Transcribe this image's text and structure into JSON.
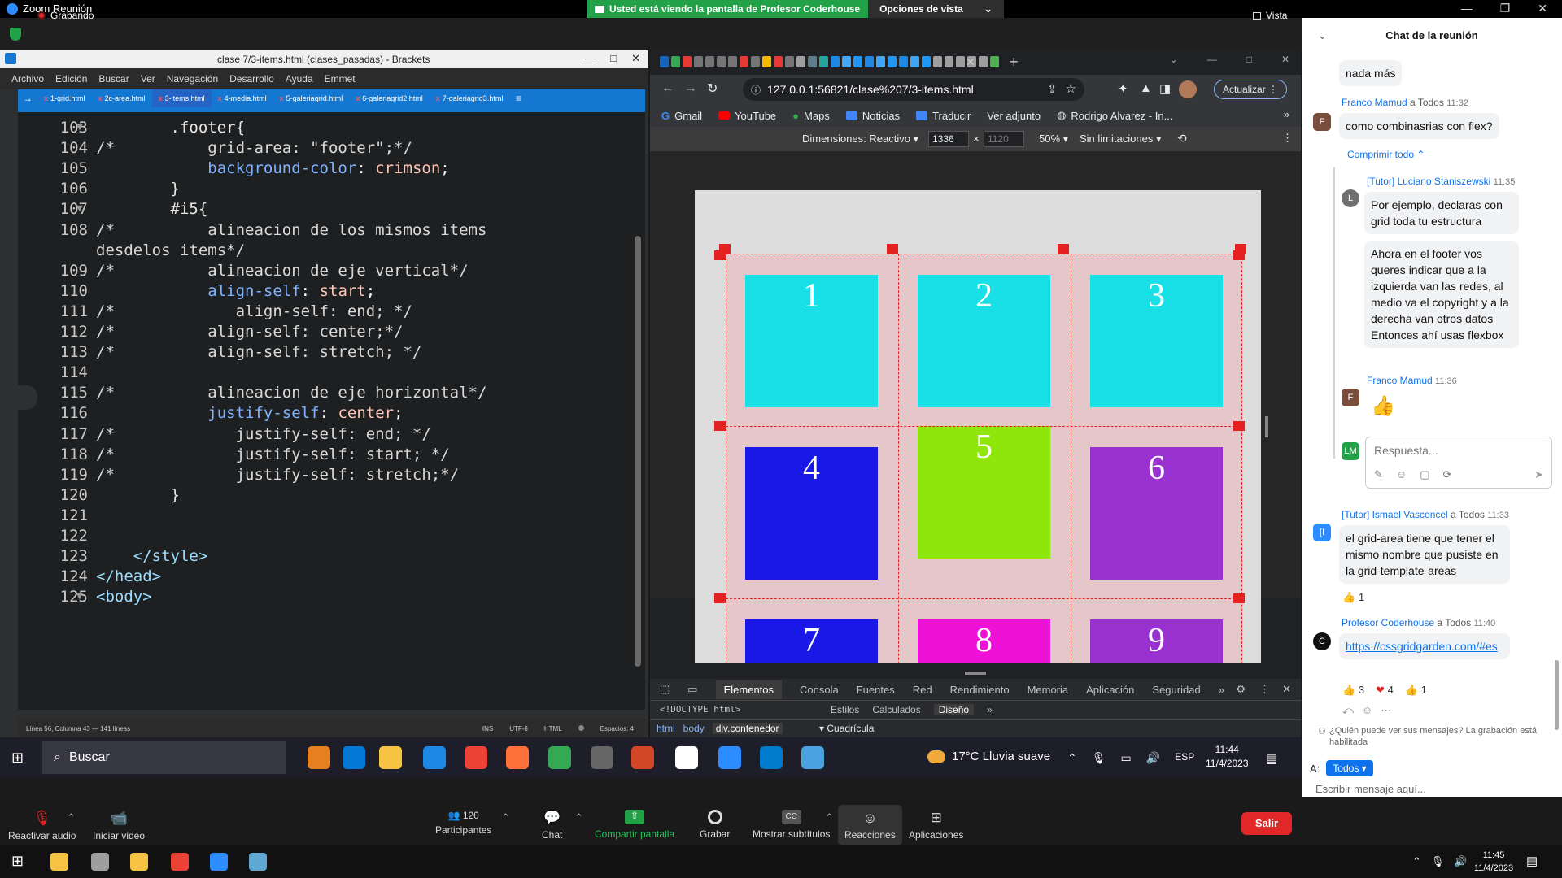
{
  "zoom": {
    "title": "Zoom Reunión",
    "banner_text": "Usted está viendo la pantalla de Profesor Coderhouse",
    "view_options": "Opciones de vista",
    "recording": "Grabando",
    "view": "Vista"
  },
  "brackets": {
    "title": "clase 7/3-items.html (clases_pasadas) - Brackets",
    "menu": [
      "Archivo",
      "Edición",
      "Buscar",
      "Ver",
      "Navegación",
      "Desarrollo",
      "Ayuda",
      "Emmet"
    ],
    "tabs": [
      "1-grid.html",
      "2c-area.html",
      "3-items.html",
      "4-media.html",
      "5-galeriagrid.html",
      "6-galeriagrid2.html",
      "7-galeriagrid3.html"
    ],
    "status_left": "Línea 56, Columna 43 — 141 líneas",
    "status_right": [
      "INS",
      "UTF-8",
      "HTML",
      "Espacios: 4"
    ],
    "lines": [
      {
        "n": "103",
        "fold": true,
        "code": "        .footer{"
      },
      {
        "n": "104",
        "fold": false,
        "code": "/*          grid-area: \"footer\";*/"
      },
      {
        "n": "105",
        "fold": false,
        "code": "            background-color: crimson;"
      },
      {
        "n": "106",
        "fold": false,
        "code": "        }"
      },
      {
        "n": "107",
        "fold": true,
        "code": "        #i5{"
      },
      {
        "n": "108",
        "fold": false,
        "code": "/*          alineacion de los mismos items"
      },
      {
        "n": "",
        "fold": false,
        "code": "desdelos items*/"
      },
      {
        "n": "109",
        "fold": false,
        "code": "/*          alineacion de eje vertical*/"
      },
      {
        "n": "110",
        "fold": false,
        "code": "            align-self: start;"
      },
      {
        "n": "111",
        "fold": false,
        "code": "/*             align-self: end; */"
      },
      {
        "n": "112",
        "fold": false,
        "code": "/*          align-self: center;*/"
      },
      {
        "n": "113",
        "fold": false,
        "code": "/*          align-self: stretch; */"
      },
      {
        "n": "114",
        "fold": false,
        "code": ""
      },
      {
        "n": "115",
        "fold": false,
        "code": "/*          alineacion de eje horizontal*/"
      },
      {
        "n": "116",
        "fold": false,
        "code": "            justify-self: center;"
      },
      {
        "n": "117",
        "fold": false,
        "code": "/*             justify-self: end; */"
      },
      {
        "n": "118",
        "fold": false,
        "code": "/*             justify-self: start; */"
      },
      {
        "n": "119",
        "fold": false,
        "code": "/*             justify-self: stretch;*/"
      },
      {
        "n": "120",
        "fold": false,
        "code": "        }"
      },
      {
        "n": "121",
        "fold": false,
        "code": ""
      },
      {
        "n": "122",
        "fold": false,
        "code": ""
      },
      {
        "n": "123",
        "fold": false,
        "code": "    </style>"
      },
      {
        "n": "124",
        "fold": false,
        "code": "</head>"
      },
      {
        "n": "125",
        "fold": true,
        "code": "<body>"
      }
    ]
  },
  "chrome": {
    "url": "127.0.0.1:56821/clase%207/3-items.html",
    "update": "Actualizar",
    "bookmarks": [
      "Gmail",
      "YouTube",
      "Maps",
      "Noticias",
      "Traducir",
      "Ver adjunto",
      "Rodrigo Alvarez - In..."
    ],
    "device_label": "Dimensiones: Reactivo",
    "width": "1336",
    "height": "1120",
    "zoom": "50%",
    "throttle": "Sin limitaciones",
    "cells": [
      {
        "label": "1",
        "color": "#19e0e6"
      },
      {
        "label": "2",
        "color": "#19e0e6"
      },
      {
        "label": "3",
        "color": "#19e0e6"
      },
      {
        "label": "4",
        "color": "#1a18e6"
      },
      {
        "label": "5",
        "color": "#8fe60a"
      },
      {
        "label": "6",
        "color": "#9931d1"
      },
      {
        "label": "7",
        "color": "#1a18e6"
      },
      {
        "label": "8",
        "color": "#ee12d8"
      },
      {
        "label": "9",
        "color": "#9931d1"
      }
    ],
    "devtools_tabs": [
      "Elementos",
      "Consola",
      "Fuentes",
      "Red",
      "Rendimiento",
      "Memoria",
      "Aplicación",
      "Seguridad"
    ],
    "doctype": "<!DOCTYPE html>",
    "style_tabs": [
      "Estilos",
      "Calculados",
      "Diseño"
    ],
    "breadcrumb": [
      "html",
      "body",
      "div.contenedor"
    ],
    "grid_section": "Cuadrícula"
  },
  "chat": {
    "title": "Chat de la reunión",
    "msg0": "nada más",
    "m1_name": "Franco Mamud",
    "m1_to": "a Todos",
    "m1_time": "11:32",
    "m1_text": "como combinasrias con flex?",
    "collapse": "Comprimir todo",
    "m2_name": "[Tutor] Luciano Staniszewski",
    "m2_time": "11:35",
    "m2_text": "Por ejemplo, declaras con grid toda tu estructura",
    "m3_text": "Ahora en el footer vos queres indicar que a la izquierda van las redes, al medio va el copyright y a la derecha van otros datos Entonces ahí usas flexbox",
    "m4_name": "Franco Mamud",
    "m4_time": "11:36",
    "reply_placeholder": "Respuesta...",
    "m5_name": "[Tutor] Ismael Vasconcel",
    "m5_to": "a Todos",
    "m5_time": "11:33",
    "m5_text": "el grid-area tiene que tener el mismo nombre que pusiste en la grid-template-areas",
    "m5_react": "1",
    "m6_name": "Profesor Coderhouse",
    "m6_to": "a Todos",
    "m6_time": "11:40",
    "m6_text": "https://cssgridgarden.com/#es",
    "m6_reacts": [
      "3",
      "4",
      "1"
    ],
    "privacy": "¿Quién puede ver sus mensajes? La grabación está habilitada",
    "to_label": "A:",
    "to_value": "Todos",
    "input_placeholder": "Escribir mensaje aquí..."
  },
  "taskbar": {
    "search": "Buscar",
    "weather": "17°C  Lluvia suave",
    "lang": "ESP",
    "time": "11:44",
    "date": "11/4/2023"
  },
  "controls": {
    "audio": "Reactivar audio",
    "video": "Iniciar video",
    "participants": "Participantes",
    "participants_count": "120",
    "chat": "Chat",
    "share": "Compartir pantalla",
    "record": "Grabar",
    "captions": "Mostrar subtítulos",
    "reactions": "Reacciones",
    "apps": "Aplicaciones",
    "leave": "Salir"
  },
  "outer_taskbar": {
    "time": "11:45",
    "date": "11/4/2023"
  }
}
